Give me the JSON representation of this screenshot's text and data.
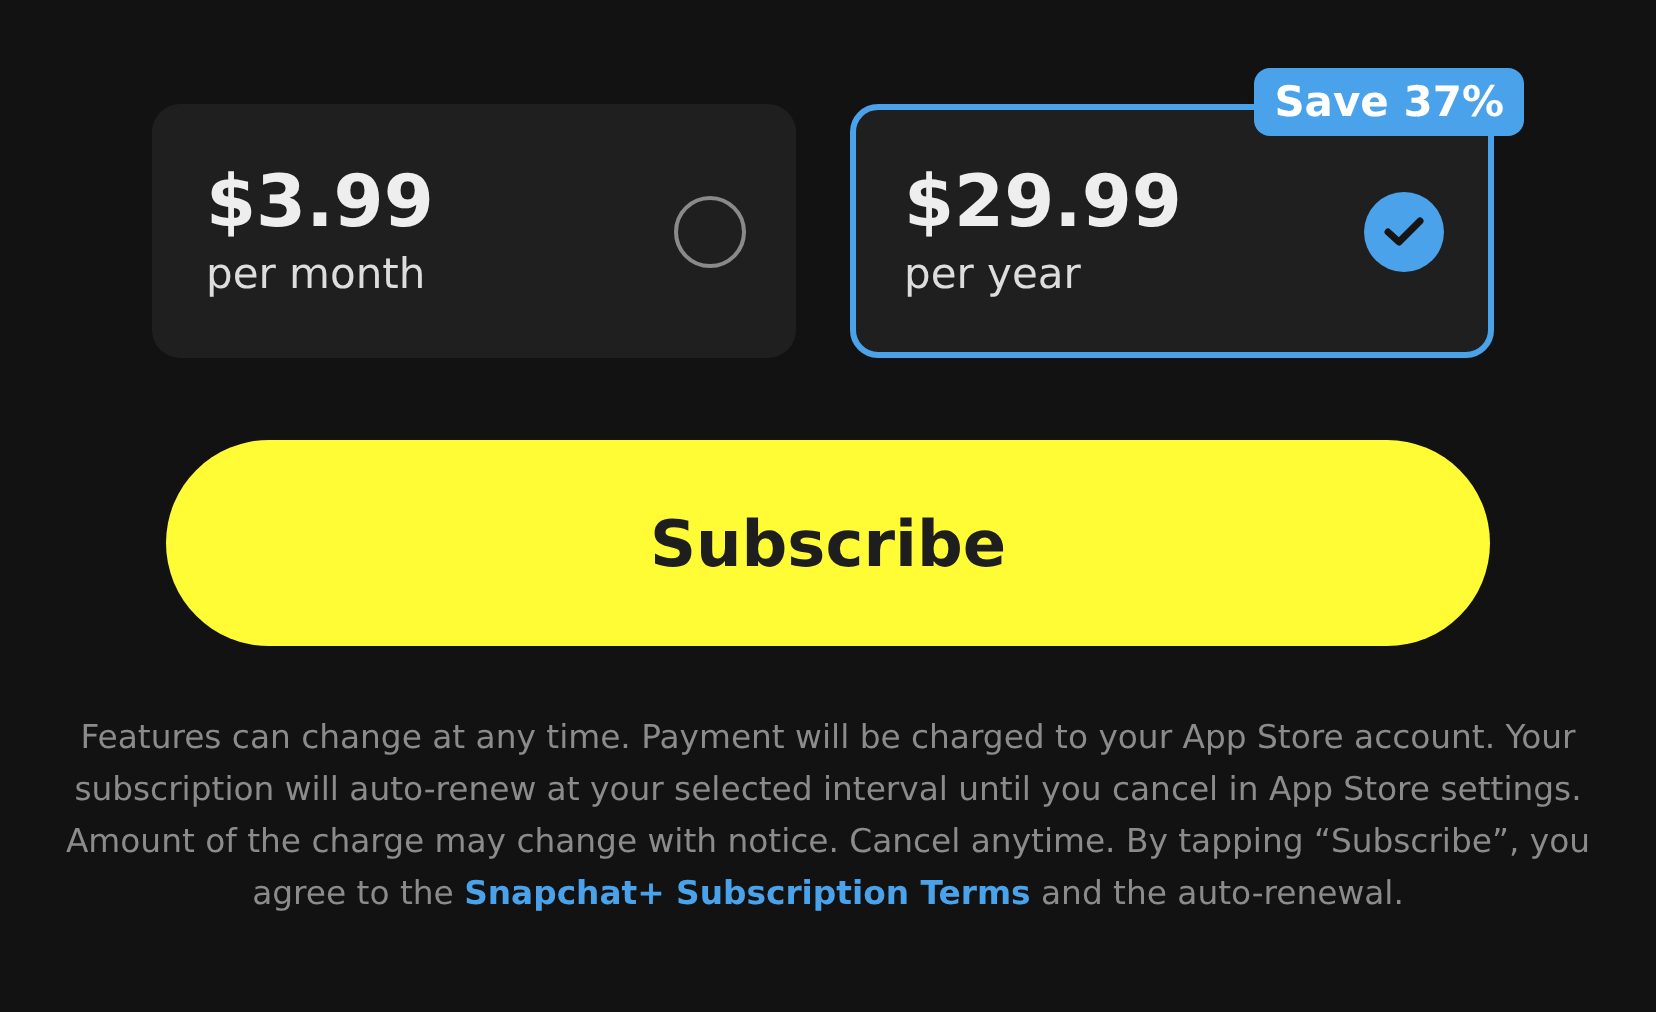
{
  "plans": [
    {
      "price": "$3.99",
      "period": "per month",
      "selected": false
    },
    {
      "price": "$29.99",
      "period": "per year",
      "selected": true,
      "badge": "Save 37%"
    }
  ],
  "subscribe_button": "Subscribe",
  "legal": {
    "before": "Features can change at any time. Payment will be charged to your App Store account. Your subscription will auto-renew at your selected interval until you cancel in App Store settings. Amount of the charge may change with notice. Cancel anytime. By tapping “Subscribe”, you agree to the",
    "link": "Snapchat+ Subscription Terms",
    "after": "and the auto-renewal."
  }
}
